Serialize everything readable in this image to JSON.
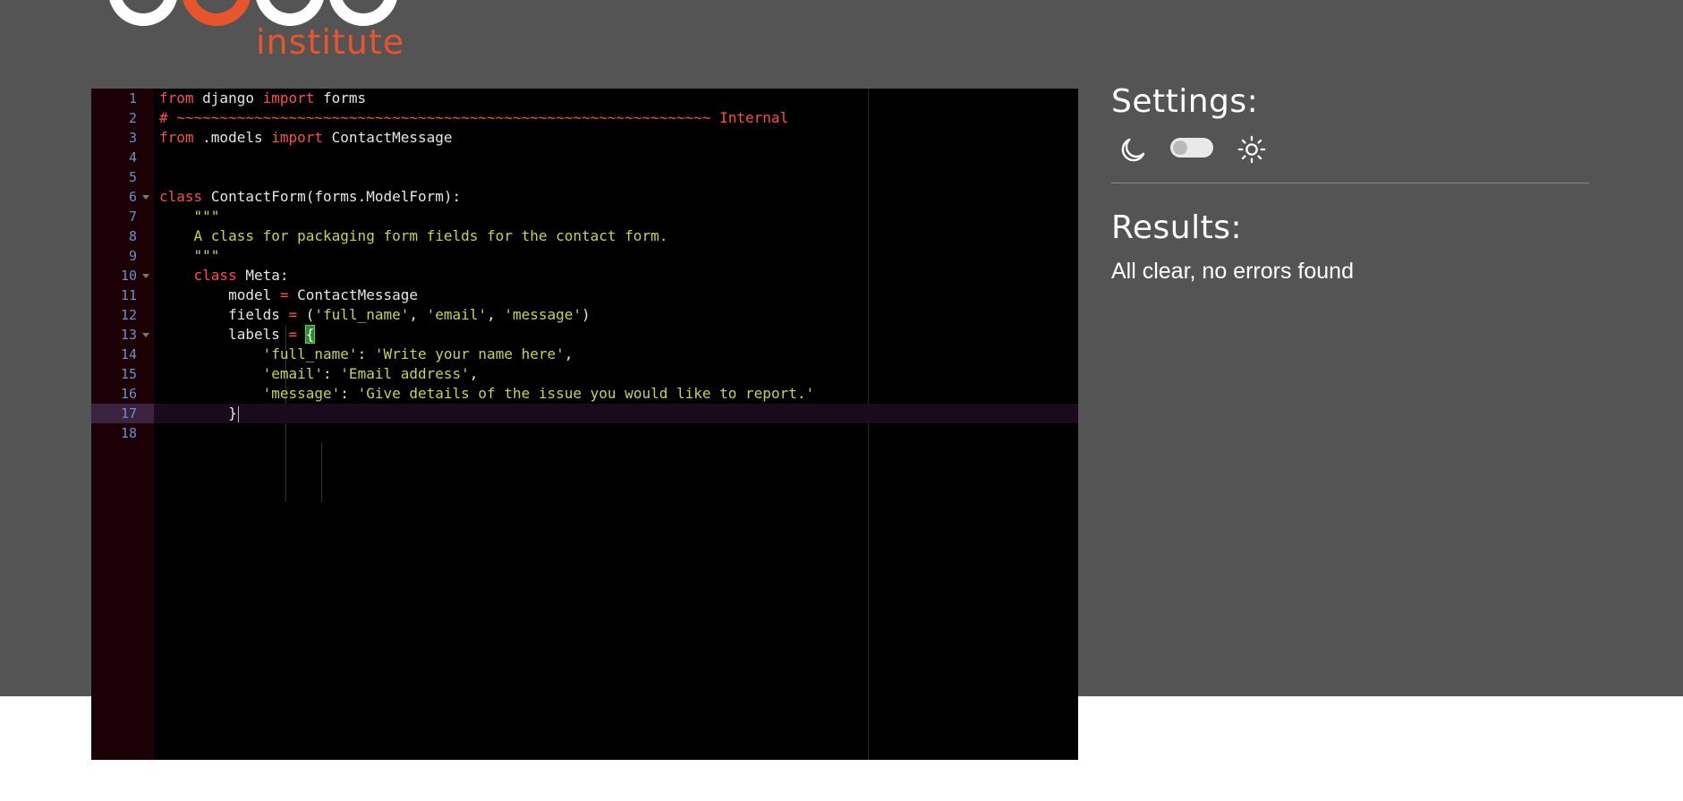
{
  "brand": {
    "word": "institute",
    "accent_color": "#e8542c",
    "mark_color": "#ffffff"
  },
  "editor": {
    "active_line": 17,
    "lines": [
      {
        "n": "1",
        "parts": [
          [
            "kw",
            "from"
          ],
          [
            "t",
            " django "
          ],
          [
            "kw",
            "import"
          ],
          [
            "t",
            " forms"
          ]
        ]
      },
      {
        "n": "2",
        "parts": [
          [
            "cm",
            "# ~~~~~~~~~~~~~~~~~~~~~~~~~~~~~~~~~~~~~~~~~~~~~~~~~~~~~~~~~~~~~~ Internal"
          ]
        ]
      },
      {
        "n": "3",
        "parts": [
          [
            "kw",
            "from"
          ],
          [
            "t",
            " .models "
          ],
          [
            "kw",
            "import"
          ],
          [
            "t",
            " ContactMessage"
          ]
        ]
      },
      {
        "n": "4",
        "parts": []
      },
      {
        "n": "5",
        "parts": []
      },
      {
        "n": "6",
        "fold": true,
        "parts": [
          [
            "kw",
            "class"
          ],
          [
            "t",
            " ContactForm(forms.ModelForm):"
          ]
        ]
      },
      {
        "n": "7",
        "parts": [
          [
            "t",
            "    "
          ],
          [
            "st",
            "\"\"\""
          ]
        ]
      },
      {
        "n": "8",
        "parts": [
          [
            "t",
            "    "
          ],
          [
            "st",
            "A class for packaging form fields for the contact form."
          ]
        ]
      },
      {
        "n": "9",
        "parts": [
          [
            "t",
            "    "
          ],
          [
            "st",
            "\"\"\""
          ]
        ]
      },
      {
        "n": "10",
        "fold": true,
        "parts": [
          [
            "t",
            "    "
          ],
          [
            "kw",
            "class"
          ],
          [
            "t",
            " Meta:"
          ]
        ]
      },
      {
        "n": "11",
        "parts": [
          [
            "t",
            "        model "
          ],
          [
            "op",
            "="
          ],
          [
            "t",
            " ContactMessage"
          ]
        ]
      },
      {
        "n": "12",
        "parts": [
          [
            "t",
            "        fields "
          ],
          [
            "op",
            "="
          ],
          [
            "t",
            " ("
          ],
          [
            "st",
            "'full_name'"
          ],
          [
            "t",
            ", "
          ],
          [
            "st",
            "'email'"
          ],
          [
            "t",
            ", "
          ],
          [
            "st",
            "'message'"
          ],
          [
            "t",
            ")"
          ]
        ]
      },
      {
        "n": "13",
        "fold": true,
        "parts": [
          [
            "t",
            "        labels "
          ],
          [
            "op",
            "="
          ],
          [
            "t",
            " "
          ],
          [
            "br",
            "{"
          ]
        ]
      },
      {
        "n": "14",
        "parts": [
          [
            "t",
            "            "
          ],
          [
            "st",
            "'full_name'"
          ],
          [
            "t",
            ": "
          ],
          [
            "st",
            "'Write your name here'"
          ],
          [
            "t",
            ","
          ]
        ]
      },
      {
        "n": "15",
        "parts": [
          [
            "t",
            "            "
          ],
          [
            "st",
            "'email'"
          ],
          [
            "t",
            ": "
          ],
          [
            "st",
            "'Email address'"
          ],
          [
            "t",
            ","
          ]
        ]
      },
      {
        "n": "16",
        "parts": [
          [
            "t",
            "            "
          ],
          [
            "st",
            "'message'"
          ],
          [
            "t",
            ": "
          ],
          [
            "st",
            "'Give details of the issue you would like to report.'"
          ]
        ]
      },
      {
        "n": "17",
        "parts": [
          [
            "t",
            "        }"
          ],
          [
            "cur",
            ""
          ]
        ]
      },
      {
        "n": "18",
        "parts": []
      }
    ]
  },
  "settings": {
    "title": "Settings:",
    "dark_icon": "moon-icon",
    "light_icon": "sun-icon",
    "theme_toggle_on": false
  },
  "results": {
    "title": "Results:",
    "message": "All clear, no errors found"
  }
}
